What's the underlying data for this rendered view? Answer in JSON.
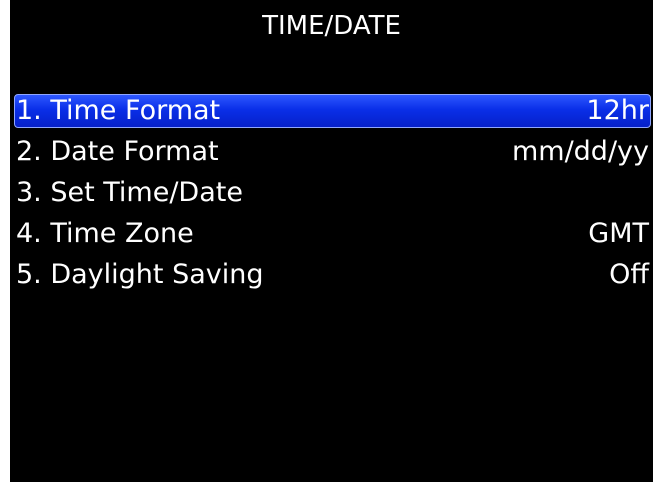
{
  "screen": {
    "title": "TIME/DATE",
    "colors": {
      "background": "#000000",
      "text": "#ffffff",
      "highlight": "#0a2fe8"
    }
  },
  "menu": {
    "selected_index": 0,
    "items": [
      {
        "label": "1. Time Format",
        "value": "12hr"
      },
      {
        "label": "2. Date Format",
        "value": "mm/dd/yy"
      },
      {
        "label": "3. Set Time/Date",
        "value": ""
      },
      {
        "label": "4. Time Zone",
        "value": "GMT"
      },
      {
        "label": "5. Daylight Saving",
        "value": "Off"
      }
    ]
  }
}
